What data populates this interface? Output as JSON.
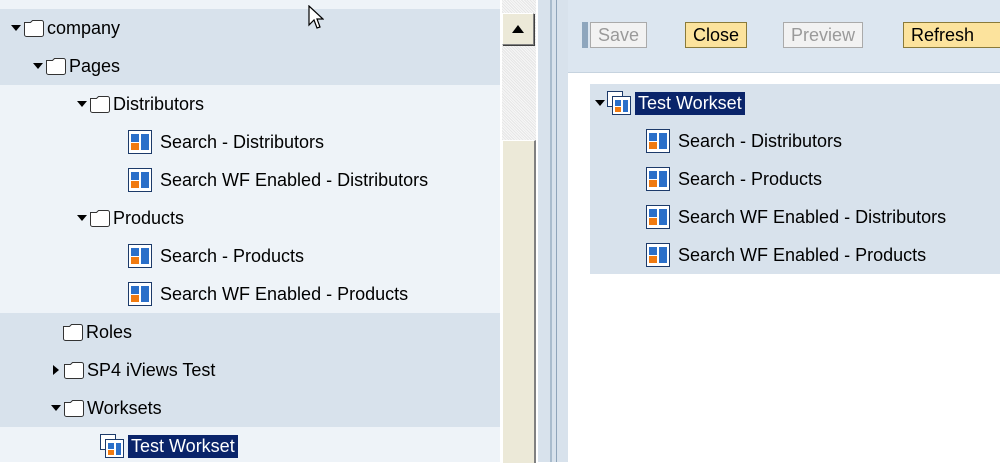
{
  "tree": {
    "company": "company",
    "pages": "Pages",
    "distributors": "Distributors",
    "search_distributors": "Search - Distributors",
    "search_wf_distributors": "Search WF Enabled - Distributors",
    "products": "Products",
    "search_products": "Search - Products",
    "search_wf_products": "Search WF Enabled - Products",
    "roles": "Roles",
    "sp4": "SP4 iViews Test",
    "worksets": "Worksets",
    "test_workset": "Test Workset"
  },
  "toolbar": {
    "save": "Save",
    "close": "Close",
    "preview": "Preview",
    "refresh": "Refresh"
  },
  "editor": {
    "root": "Test Workset",
    "items": [
      "Search - Distributors",
      "Search - Products",
      "Search WF Enabled - Distributors",
      "Search WF Enabled - Products"
    ]
  },
  "colors": {
    "selection": "#0a246a",
    "active_button": "#fce39d",
    "row_band": "#d8e2ec"
  }
}
